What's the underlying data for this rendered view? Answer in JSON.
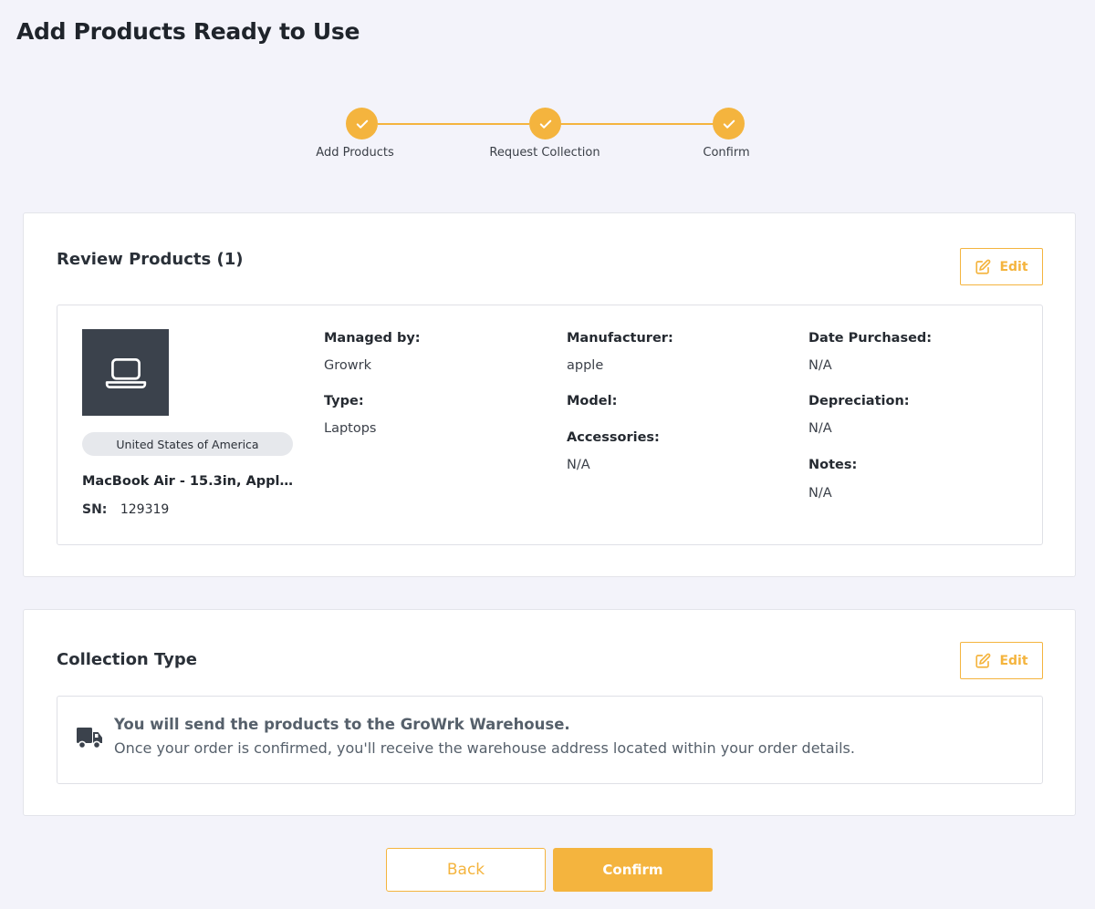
{
  "page": {
    "title": "Add Products Ready to Use"
  },
  "stepper": {
    "steps": [
      {
        "label": "Add Products",
        "completed": true
      },
      {
        "label": "Request Collection",
        "completed": true
      },
      {
        "label": "Confirm",
        "completed": true
      }
    ]
  },
  "review": {
    "title": "Review Products (1)",
    "edit_label": "Edit",
    "product": {
      "icon": "laptop-icon",
      "country": "United States of America",
      "name": "MacBook Air - 15.3in, Apple ...",
      "sn_label": "SN:",
      "sn_value": "129319",
      "fields": {
        "managed_by": {
          "label": "Managed by:",
          "value": "Growrk"
        },
        "type": {
          "label": "Type:",
          "value": "Laptops"
        },
        "manufacturer": {
          "label": "Manufacturer:",
          "value": "apple"
        },
        "model": {
          "label": "Model:",
          "value": ""
        },
        "accessories": {
          "label": "Accessories:",
          "value": "N/A"
        },
        "date_purchased": {
          "label": "Date Purchased:",
          "value": "N/A"
        },
        "depreciation": {
          "label": "Depreciation:",
          "value": "N/A"
        },
        "notes": {
          "label": "Notes:",
          "value": "N/A"
        }
      }
    }
  },
  "collection": {
    "title": "Collection Type",
    "edit_label": "Edit",
    "icon": "truck-icon",
    "heading": "You will send the products to the GroWrk Warehouse.",
    "description": "Once your order is confirmed, you'll receive the warehouse address located within your order details."
  },
  "actions": {
    "back_label": "Back",
    "confirm_label": "Confirm"
  },
  "colors": {
    "accent": "#f4b43e",
    "thumb_bg": "#3b424c",
    "page_bg": "#f3f3fa"
  }
}
